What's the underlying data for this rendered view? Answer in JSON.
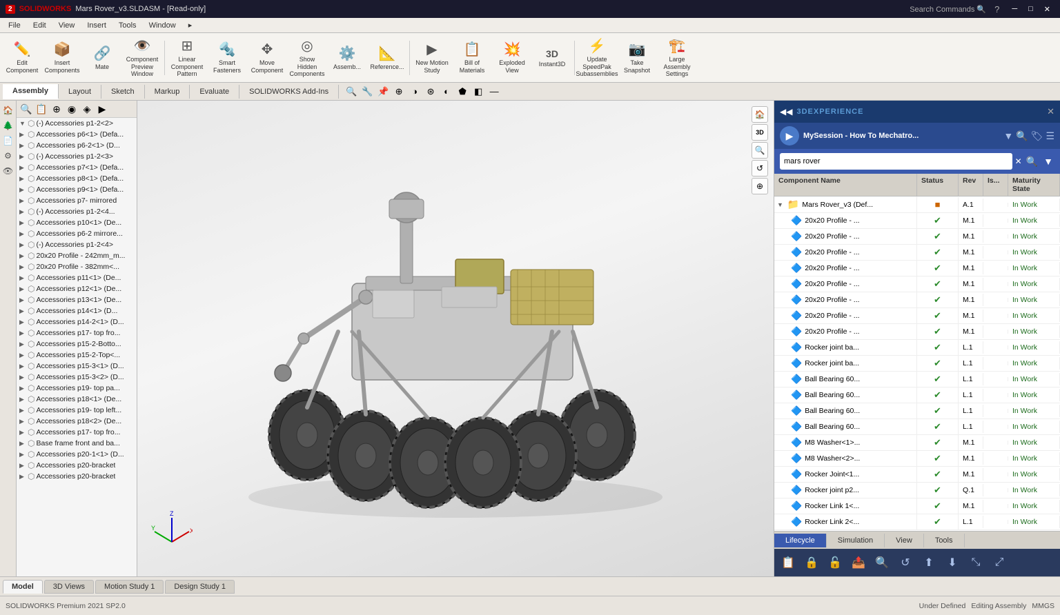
{
  "titlebar": {
    "logo": "SOLIDWORKS",
    "title": "Mars Rover_v3.SLDASM - [Read-only]",
    "controls": [
      "─",
      "□",
      "✕"
    ]
  },
  "menubar": {
    "items": [
      "File",
      "Edit",
      "View",
      "Insert",
      "Tools",
      "Window"
    ]
  },
  "toolbar": {
    "buttons": [
      {
        "id": "edit",
        "icon": "✏️",
        "label": "Edit\nComponent"
      },
      {
        "id": "insert-components",
        "icon": "📦",
        "label": "Insert\nComponents"
      },
      {
        "id": "mate",
        "icon": "🔗",
        "label": "Mate"
      },
      {
        "id": "component-preview",
        "icon": "👁️",
        "label": "Component\nPreview Window"
      },
      {
        "id": "linear-pattern",
        "icon": "⊞",
        "label": "Linear\nComponent Pattern"
      },
      {
        "id": "smart-fasteners",
        "icon": "🔩",
        "label": "Smart\nFasteners"
      },
      {
        "id": "move-component",
        "icon": "↔️",
        "label": "Move\nComponent"
      },
      {
        "id": "show-hidden",
        "icon": "◎",
        "label": "Show Hidden\nComponents"
      },
      {
        "id": "assembly",
        "icon": "⚙️",
        "label": "Assemb..."
      },
      {
        "id": "reference",
        "icon": "📐",
        "label": "Reference..."
      },
      {
        "id": "new-motion-study",
        "icon": "▶",
        "label": "New Motion\nStudy"
      },
      {
        "id": "bill-of-materials",
        "icon": "📋",
        "label": "Bill of\nMaterials"
      },
      {
        "id": "exploded-view",
        "icon": "💥",
        "label": "Exploded\nView"
      },
      {
        "id": "instant3d",
        "icon": "3D",
        "label": "Instant3D"
      },
      {
        "id": "update-speedpak",
        "icon": "⚡",
        "label": "Update\nSpeedPak\nSubassemblies"
      },
      {
        "id": "take-snapshot",
        "icon": "📷",
        "label": "Take\nSnapshot"
      },
      {
        "id": "large-assembly",
        "icon": "🏗️",
        "label": "Large Assembly\nSettings"
      }
    ]
  },
  "tabs": {
    "items": [
      "Assembly",
      "Layout",
      "Sketch",
      "Markup",
      "Evaluate",
      "SOLIDWORKS Add-Ins"
    ],
    "active": "Assembly"
  },
  "tree_items": [
    {
      "label": "(-) Accessories p1-2<2>",
      "depth": 0,
      "expand": true
    },
    {
      "label": "Accessories p6<1> (Defa...",
      "depth": 0
    },
    {
      "label": "Accessories p6-2<1> (D...",
      "depth": 0
    },
    {
      "label": "(-) Accessories p1-2<3>",
      "depth": 0
    },
    {
      "label": "Accessories p7<1> (Defa...",
      "depth": 0
    },
    {
      "label": "Accessories p8<1> (Defa...",
      "depth": 0
    },
    {
      "label": "Accessories p9<1> (Defa...",
      "depth": 0
    },
    {
      "label": "Accessories p7- mirrored",
      "depth": 0
    },
    {
      "label": "(-) Accessories p1-2<4...",
      "depth": 0
    },
    {
      "label": "Accessories p10<1> (De...",
      "depth": 0
    },
    {
      "label": "Accessories p6-2 mirrore...",
      "depth": 0
    },
    {
      "label": "(-) Accessories p1-2<4>",
      "depth": 0
    },
    {
      "label": "20x20 Profile - 242mm_m...",
      "depth": 0
    },
    {
      "label": "20x20 Profile - 382mm<...",
      "depth": 0
    },
    {
      "label": "Accessories p11<1> (De...",
      "depth": 0
    },
    {
      "label": "Accessories p12<1> (De...",
      "depth": 0
    },
    {
      "label": "Accessories p13<1> (De...",
      "depth": 0
    },
    {
      "label": "Accessories p14<1> (D...",
      "depth": 0
    },
    {
      "label": "Accessories p14-2<1> (D...",
      "depth": 0
    },
    {
      "label": "Accessories p17- top fro...",
      "depth": 0
    },
    {
      "label": "Accessories p15-2-Botto...",
      "depth": 0
    },
    {
      "label": "Accessories p15-2-Top<...",
      "depth": 0
    },
    {
      "label": "Accessories p15-3<1> (D...",
      "depth": 0
    },
    {
      "label": "Accessories p15-3<2> (D...",
      "depth": 0
    },
    {
      "label": "Accessories p19- top pa...",
      "depth": 0
    },
    {
      "label": "Accessories p18<1> (De...",
      "depth": 0
    },
    {
      "label": "Accessories p19- top left...",
      "depth": 0
    },
    {
      "label": "Accessories p18<2> (De...",
      "depth": 0
    },
    {
      "label": "Accessories p17- top fro...",
      "depth": 0
    },
    {
      "label": "Base frame front and ba...",
      "depth": 0
    },
    {
      "label": "Accessories p20-1<1> (D...",
      "depth": 0
    },
    {
      "label": "Accessories p20-bracket",
      "depth": 0
    },
    {
      "label": "Accessories p20-bracket",
      "depth": 0
    }
  ],
  "right_panel": {
    "header": "3DEXPERIENCE",
    "session_name": "MySession - How To Mechatro...",
    "search_placeholder": "mars rover",
    "search_value": "mars rover",
    "table": {
      "columns": [
        "Component Name",
        "Status",
        "Rev",
        "Is...",
        "Maturity State"
      ],
      "rows": [
        {
          "indent": 0,
          "expand": true,
          "icon": "folder",
          "name": "Mars Rover_v3 (Def...",
          "status": "orange",
          "rev": "A.1",
          "is": "",
          "maturity": "In Work"
        },
        {
          "indent": 1,
          "expand": false,
          "icon": "part",
          "name": "20x20 Profile - ...",
          "status": "green",
          "rev": "M.1",
          "is": "",
          "maturity": "In Work"
        },
        {
          "indent": 1,
          "expand": false,
          "icon": "part",
          "name": "20x20 Profile - ...",
          "status": "green",
          "rev": "M.1",
          "is": "",
          "maturity": "In Work"
        },
        {
          "indent": 1,
          "expand": false,
          "icon": "part",
          "name": "20x20 Profile - ...",
          "status": "green",
          "rev": "M.1",
          "is": "",
          "maturity": "In Work"
        },
        {
          "indent": 1,
          "expand": false,
          "icon": "part",
          "name": "20x20 Profile - ...",
          "status": "green",
          "rev": "M.1",
          "is": "",
          "maturity": "In Work"
        },
        {
          "indent": 1,
          "expand": false,
          "icon": "part",
          "name": "20x20 Profile - ...",
          "status": "green",
          "rev": "M.1",
          "is": "",
          "maturity": "In Work"
        },
        {
          "indent": 1,
          "expand": false,
          "icon": "part",
          "name": "20x20 Profile - ...",
          "status": "green",
          "rev": "M.1",
          "is": "",
          "maturity": "In Work"
        },
        {
          "indent": 1,
          "expand": false,
          "icon": "part",
          "name": "20x20 Profile - ...",
          "status": "green",
          "rev": "M.1",
          "is": "",
          "maturity": "In Work"
        },
        {
          "indent": 1,
          "expand": false,
          "icon": "part",
          "name": "20x20 Profile - ...",
          "status": "green",
          "rev": "M.1",
          "is": "",
          "maturity": "In Work"
        },
        {
          "indent": 1,
          "expand": false,
          "icon": "part",
          "name": "Rocker joint ba...",
          "status": "green",
          "rev": "L.1",
          "is": "",
          "maturity": "In Work"
        },
        {
          "indent": 1,
          "expand": false,
          "icon": "part",
          "name": "Rocker joint ba...",
          "status": "green",
          "rev": "L.1",
          "is": "",
          "maturity": "In Work"
        },
        {
          "indent": 1,
          "expand": false,
          "icon": "part",
          "name": "Ball Bearing 60...",
          "status": "green",
          "rev": "L.1",
          "is": "",
          "maturity": "In Work"
        },
        {
          "indent": 1,
          "expand": false,
          "icon": "part",
          "name": "Ball Bearing 60...",
          "status": "green",
          "rev": "L.1",
          "is": "",
          "maturity": "In Work"
        },
        {
          "indent": 1,
          "expand": false,
          "icon": "part",
          "name": "Ball Bearing 60...",
          "status": "green",
          "rev": "L.1",
          "is": "",
          "maturity": "In Work"
        },
        {
          "indent": 1,
          "expand": false,
          "icon": "part",
          "name": "Ball Bearing 60...",
          "status": "green",
          "rev": "L.1",
          "is": "",
          "maturity": "In Work"
        },
        {
          "indent": 1,
          "expand": false,
          "icon": "part",
          "name": "M8 Washer<1>...",
          "status": "green",
          "rev": "M.1",
          "is": "",
          "maturity": "In Work"
        },
        {
          "indent": 1,
          "expand": false,
          "icon": "part",
          "name": "M8 Washer<2>...",
          "status": "green",
          "rev": "M.1",
          "is": "",
          "maturity": "In Work"
        },
        {
          "indent": 1,
          "expand": false,
          "icon": "part",
          "name": "Rocker Joint<1...",
          "status": "green",
          "rev": "M.1",
          "is": "",
          "maturity": "In Work"
        },
        {
          "indent": 1,
          "expand": false,
          "icon": "part",
          "name": "Rocker joint p2...",
          "status": "green",
          "rev": "Q.1",
          "is": "",
          "maturity": "In Work"
        },
        {
          "indent": 1,
          "expand": false,
          "icon": "part",
          "name": "Rocker Link 1<...",
          "status": "green",
          "rev": "M.1",
          "is": "",
          "maturity": "In Work"
        },
        {
          "indent": 1,
          "expand": false,
          "icon": "part",
          "name": "Rocker Link 2<...",
          "status": "green",
          "rev": "L.1",
          "is": "",
          "maturity": "In Work"
        }
      ]
    },
    "bottom_tabs": [
      "Lifecycle",
      "Simulation",
      "View",
      "Tools"
    ],
    "active_bottom_tab": "Lifecycle"
  },
  "view_tabs": {
    "items": [
      "Model",
      "3D Views",
      "Motion Study 1",
      "Design Study 1"
    ],
    "active": "Model"
  },
  "footer": {
    "status": "Under Defined",
    "mode": "Editing Assembly",
    "units": "MMGS",
    "sw_version": "SOLIDWORKS Premium 2021 SP2.0"
  }
}
